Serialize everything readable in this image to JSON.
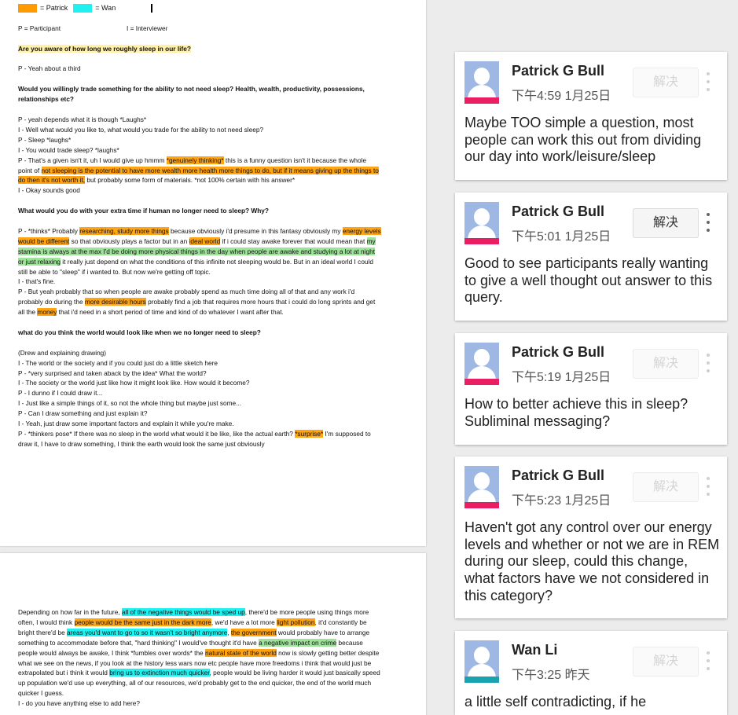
{
  "document": {
    "legend": {
      "patrick": "= Patrick",
      "wan": "= Wan"
    },
    "roles": {
      "participant": "P = Participant",
      "interviewer": "I = Interviewer"
    },
    "q1": "Are you aware of how long we roughly sleep in our life?",
    "a1": "P - Yeah about a third",
    "q2": "Would you willingly trade something for the ability to not need sleep? Health, wealth, productivity, possessions, relationships etc?",
    "d2": {
      "l1": "P - yeah depends what it is though *Laughs*",
      "l2": "I - Well what would you like to, what would you trade for the ability to not need sleep?",
      "l3": "P - Sleep *laughs*",
      "l4": "I - You would trade sleep? *laughs*",
      "l5a": "P - That's a given isn't it, uh I would give up hmmm ",
      "l5h1": "*genuinely thinking*",
      "l5b": " this is a funny question isn't it because the whole point of ",
      "l5h2": "not sleeping is the potential to have more wealth more health more things to do, but if it means giving up the things to do then it's not worth it,",
      "l5c": " but probably some form of materials. *not 100% certain with his answer*",
      "l6": "I - Okay sounds good"
    },
    "q3": "What would you do with your extra time if human no longer need to sleep? Why?",
    "d3": {
      "a": "P - *thinks* Probably ",
      "h1": "researching, study more things",
      "b": " because obviously i'd presume in this fantasy obviously my ",
      "h2": "energy levels would be different",
      "c": " so that obviously plays a factor but in an ",
      "h3": "ideal world",
      "d": " if i could stay awake forever that would mean that ",
      "h4": "my stamina is always at the max I'd be doing more physical things in the day when people are awake and studying a lot at night or just relaxing",
      "e": " it really just depend on what the conditions of this infinite not sleeping would be. But in an ideal world I could still be able to \"sleep\" if i wanted to. But now we're getting off topic.",
      "f": "I - that's fine.",
      "g": "P - But yeah probably that so when people are awake probably spend as much time doing all of that and any work i'd probably do during the ",
      "h5": "more desirable hours",
      "i": " probably find a job that requires more hours that i could do long sprints and get all the ",
      "h6": "money",
      "j": " that i'd need in a short period of time and kind of do whatever I want after that."
    },
    "q4": "what do you think the world would look like when we no longer need to sleep?",
    "d4": {
      "l1": "(Drew and explaining drawing)",
      "l2": "I - The world or the society and if you could just do a little sketch here",
      "l3": "P - *very surprised and taken aback by the idea* What the world?",
      "l4": "I - The society or the world just like how it might look like. How would it become?",
      "l5": "P - I dunno if I could draw it...",
      "l6": "I - Just like a simple things of it, so not the whole thing but maybe just some...",
      "l7": "P - Can I draw something and just explain it?",
      "l8": "I - Yeah, just draw some important factors and explain it while you're make.",
      "l9a": "P - *thinkers pose* If there was no sleep in the world what would it be like, like the actual earth? ",
      "l9h": "*surprise*",
      "l9b": " I'm supposed to draw it, I have to draw something, I think the earth would look the same just obviously"
    },
    "p2": {
      "a": "Depending on how far in the future, ",
      "h1": "all of the negative things would be sped up",
      "b": ", there'd be more people using things more often, I would think ",
      "h2": "people would be the same just in the dark more",
      "c": ", we'd have a lot more ",
      "h3": "light pollution",
      "d": ", it'd constantly be bright there'd be ",
      "h4": "areas you'd want to go to so it wasn't so bright anymore",
      "e": ", ",
      "h5": "the government",
      "f": " would probably have to arrange something to accommodate before that, \"hard thinking\" I would've thought it'd have ",
      "h6": "a negative impact on crime",
      "g": " because people would always be awake, I think *fumbles over words* the ",
      "h7": "natural state of the world",
      "h": " now is slowly getting better despite what we see on the news, if you look at the history less wars now etc people have more freedoms i think that would just be extrapolated but i think it would ",
      "h8": "bring us to extinction much quicker",
      "i": ", people would be living harder it would just basically speed up population we'd use up everything, all of our resources, we'd probably get to the end quicker, the end of the world much quicker I guess.",
      "l2": "I - do you have anything else to add here?"
    }
  },
  "comments": [
    {
      "author": "Patrick G Bull",
      "time": "下午4:59 1月25日",
      "resolve": "解决",
      "text": "Maybe TOO simple a question, most people can work this out from dividing our day into work/leisure/sleep",
      "stripe": "#e91e63"
    },
    {
      "author": "Patrick G Bull",
      "time": "下午5:01 1月25日",
      "resolve": "解决",
      "text": "Good to see participants really wanting to give a well thought out answer to this query.",
      "stripe": "#e91e63"
    },
    {
      "author": "Patrick G Bull",
      "time": "下午5:19 1月25日",
      "resolve": "解决",
      "text": "How to better achieve this in sleep? Subliminal messaging?",
      "stripe": "#e91e63"
    },
    {
      "author": "Patrick G Bull",
      "time": "下午5:23 1月25日",
      "resolve": "解决",
      "text": "Haven't got any control over our energy levels and whether or not we are in REM during our sleep, could this change, what factors have we not considered in this category?",
      "stripe": "#e91e63"
    },
    {
      "author": "Wan Li",
      "time": "下午3:25 昨天",
      "resolve": "解决",
      "text": "a little self contradicting, if he",
      "stripe": "#19a3b1"
    }
  ],
  "colors": {
    "patrick": "#ff9a00",
    "wan": "#21f0f0",
    "accent_patrick": "#e91e63",
    "accent_wan": "#19a3b1"
  },
  "icons": {
    "avatar": "person-avatar-icon",
    "more": "more-vert-icon"
  }
}
